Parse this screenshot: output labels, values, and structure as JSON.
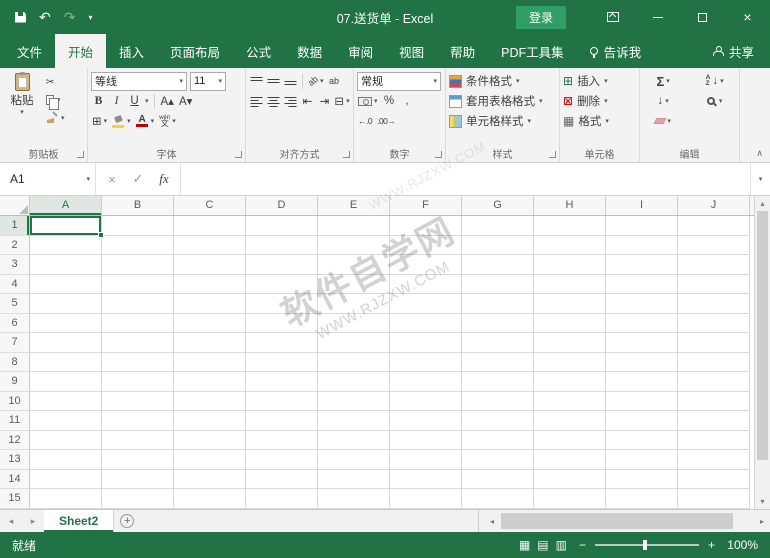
{
  "colors": {
    "brand": "#217346",
    "login": "#2f9e67",
    "ribbon_bg": "#f3f3f3",
    "grid_line": "#d9d9d9",
    "header_bg": "#f7f7f7"
  },
  "titlebar": {
    "title": "07.送货单 - Excel",
    "login_label": "登录"
  },
  "tabs": [
    {
      "label": "文件"
    },
    {
      "label": "开始"
    },
    {
      "label": "插入"
    },
    {
      "label": "页面布局"
    },
    {
      "label": "公式"
    },
    {
      "label": "数据"
    },
    {
      "label": "审阅"
    },
    {
      "label": "视图"
    },
    {
      "label": "帮助"
    },
    {
      "label": "PDF工具集"
    }
  ],
  "tell_me_label": "告诉我",
  "share_label": "共享",
  "ribbon": {
    "paste_label": "粘贴",
    "font": {
      "name": "等线",
      "size": "11"
    },
    "number": {
      "format": "常规"
    },
    "styles": [
      {
        "label": "条件格式"
      },
      {
        "label": "套用表格格式"
      },
      {
        "label": "单元格样式"
      }
    ],
    "cells": [
      {
        "label": "插入"
      },
      {
        "label": "删除"
      },
      {
        "label": "格式"
      }
    ],
    "group_labels": [
      "剪贴板",
      "字体",
      "对齐方式",
      "数字",
      "样式",
      "单元格",
      "编辑"
    ]
  },
  "formula_bar": {
    "name_box": "A1"
  },
  "grid": {
    "columns": [
      "A",
      "B",
      "C",
      "D",
      "E",
      "F",
      "G",
      "H",
      "I",
      "J"
    ],
    "row_count": 15,
    "selected_cell": "A1"
  },
  "watermark": {
    "title": "软件自学网",
    "url": "WWW.RJZXW.COM"
  },
  "sheet_bar": {
    "active_tab": "Sheet2"
  },
  "status_bar": {
    "status": "就绪",
    "zoom": "100%"
  },
  "glyphs": {
    "undo": "↶",
    "redo": "↷",
    "qat_more": "▾",
    "dropdown": "▾",
    "close": "×",
    "scissors": "✂",
    "bold": "B",
    "italic": "I",
    "underline": "U",
    "font_larger": "A▴",
    "font_smaller": "A▾",
    "borders": "⊞",
    "letter_a": "A",
    "phonetic_top": "wén",
    "phonetic_bottom": "文",
    "orient": "ab",
    "wrap": "ab",
    "indent_dec": "⇤",
    "indent_inc": "⇥",
    "merge": "⊟",
    "percent": "%",
    "comma": ",",
    "inc_decimal": "←.0",
    "dec_decimal": ".00→",
    "sigma": "Σ",
    "fill_down": "↓",
    "sort_a": "A",
    "sort_z": "Z",
    "insert_cells": "⊞",
    "delete_cells": "⊠",
    "format_cells": "▦",
    "cancel": "×",
    "check": "✓",
    "fx": "fx",
    "collapse_ribbon": "∧",
    "nav_left": "◂",
    "nav_right": "▸",
    "scroll_up": "▴",
    "scroll_down": "▾",
    "add_sheet": "+",
    "zoom_out": "−",
    "zoom_in": "+",
    "view_normal": "▦",
    "view_layout": "▤",
    "view_break": "▥"
  }
}
